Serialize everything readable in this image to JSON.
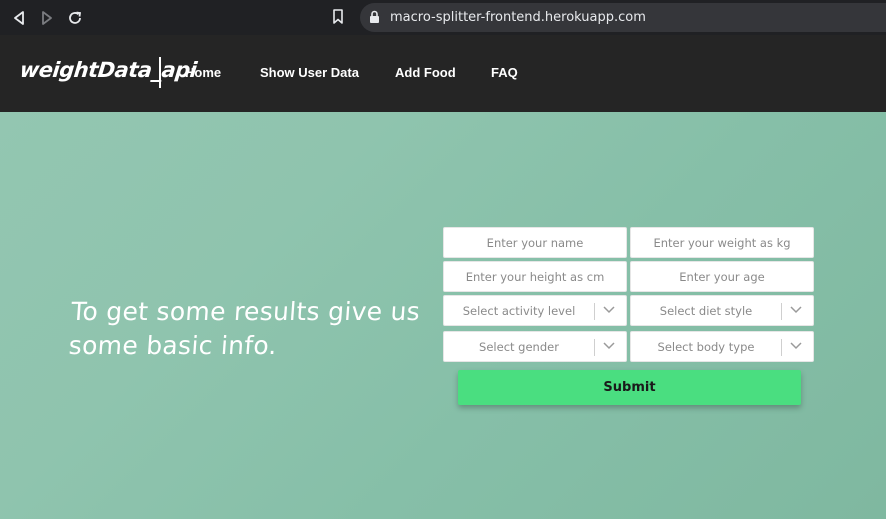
{
  "browser": {
    "url": "macro-splitter-frontend.herokuapp.com",
    "icons": [
      "back-icon",
      "forward-icon",
      "reload-icon",
      "bookmark-icon",
      "lock-icon"
    ]
  },
  "nav": {
    "logo": "weightData_api",
    "links": [
      "Home",
      "Show User Data",
      "Add Food",
      "FAQ"
    ]
  },
  "hero": {
    "headline": "To get some results give us some basic info."
  },
  "form": {
    "name_placeholder": "Enter your name",
    "weight_placeholder": "Enter your weight as kg",
    "height_placeholder": "Enter your height as cm",
    "age_placeholder": "Enter your age",
    "activity_label": "Select activity level",
    "diet_label": "Select diet style",
    "gender_label": "Select gender",
    "body_label": "Select body type",
    "submit_label": "Submit"
  },
  "colors": {
    "nav_bg": "#252525",
    "hero_bg": "#8fc4ae",
    "submit_bg": "#4ade80"
  }
}
